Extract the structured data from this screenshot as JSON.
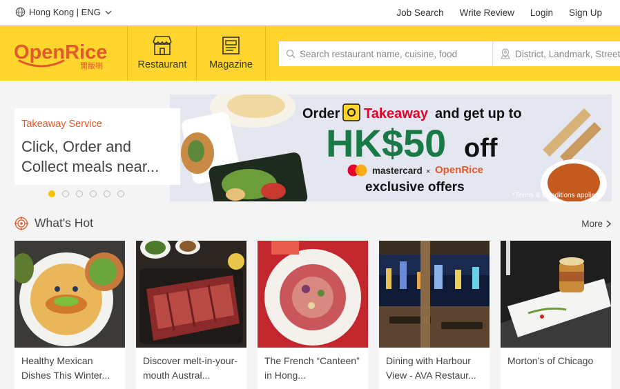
{
  "topbar": {
    "locale": "Hong Kong | ENG",
    "links": [
      "Job Search",
      "Write Review",
      "Login",
      "Sign Up"
    ]
  },
  "header": {
    "logo_text": "OpenRice",
    "logo_sub": "開飯喇",
    "nav": {
      "restaurant": "Restaurant",
      "magazine": "Magazine"
    },
    "search_placeholder": "Search restaurant name, cuisine, food",
    "district_placeholder": "District, Landmark, Street"
  },
  "promo": {
    "category": "Takeaway Service",
    "title": "Click, Order and Collect meals near...",
    "slide_count": 6,
    "active_slide": 1
  },
  "banner": {
    "line1_a": "Order",
    "line1_b": "Takeaway",
    "line1_c": "and get up to",
    "amount": "HK$50",
    "off": "off",
    "partner_a": "mastercard",
    "partner_x": "×",
    "partner_b": "OpenRice",
    "offers": "exclusive offers",
    "terms": "*Terms & Conditions applied",
    "colors": {
      "green": "#1a7a47",
      "red": "#e4002b",
      "bg": "#e4e7f0"
    }
  },
  "hot": {
    "heading": "What's Hot",
    "more": "More",
    "cards": [
      {
        "caption": "Healthy Mexican Dishes This Winter..."
      },
      {
        "caption": "Discover melt-in-your-mouth Austral..."
      },
      {
        "caption": "The French “Canteen” in Hong..."
      },
      {
        "caption": "Dining with Harbour View - AVA Restaur..."
      },
      {
        "caption": "Morton’s of Chicago"
      }
    ]
  },
  "colors": {
    "brand_yellow": "#ffd52e",
    "accent_orange": "#e15a2b"
  }
}
